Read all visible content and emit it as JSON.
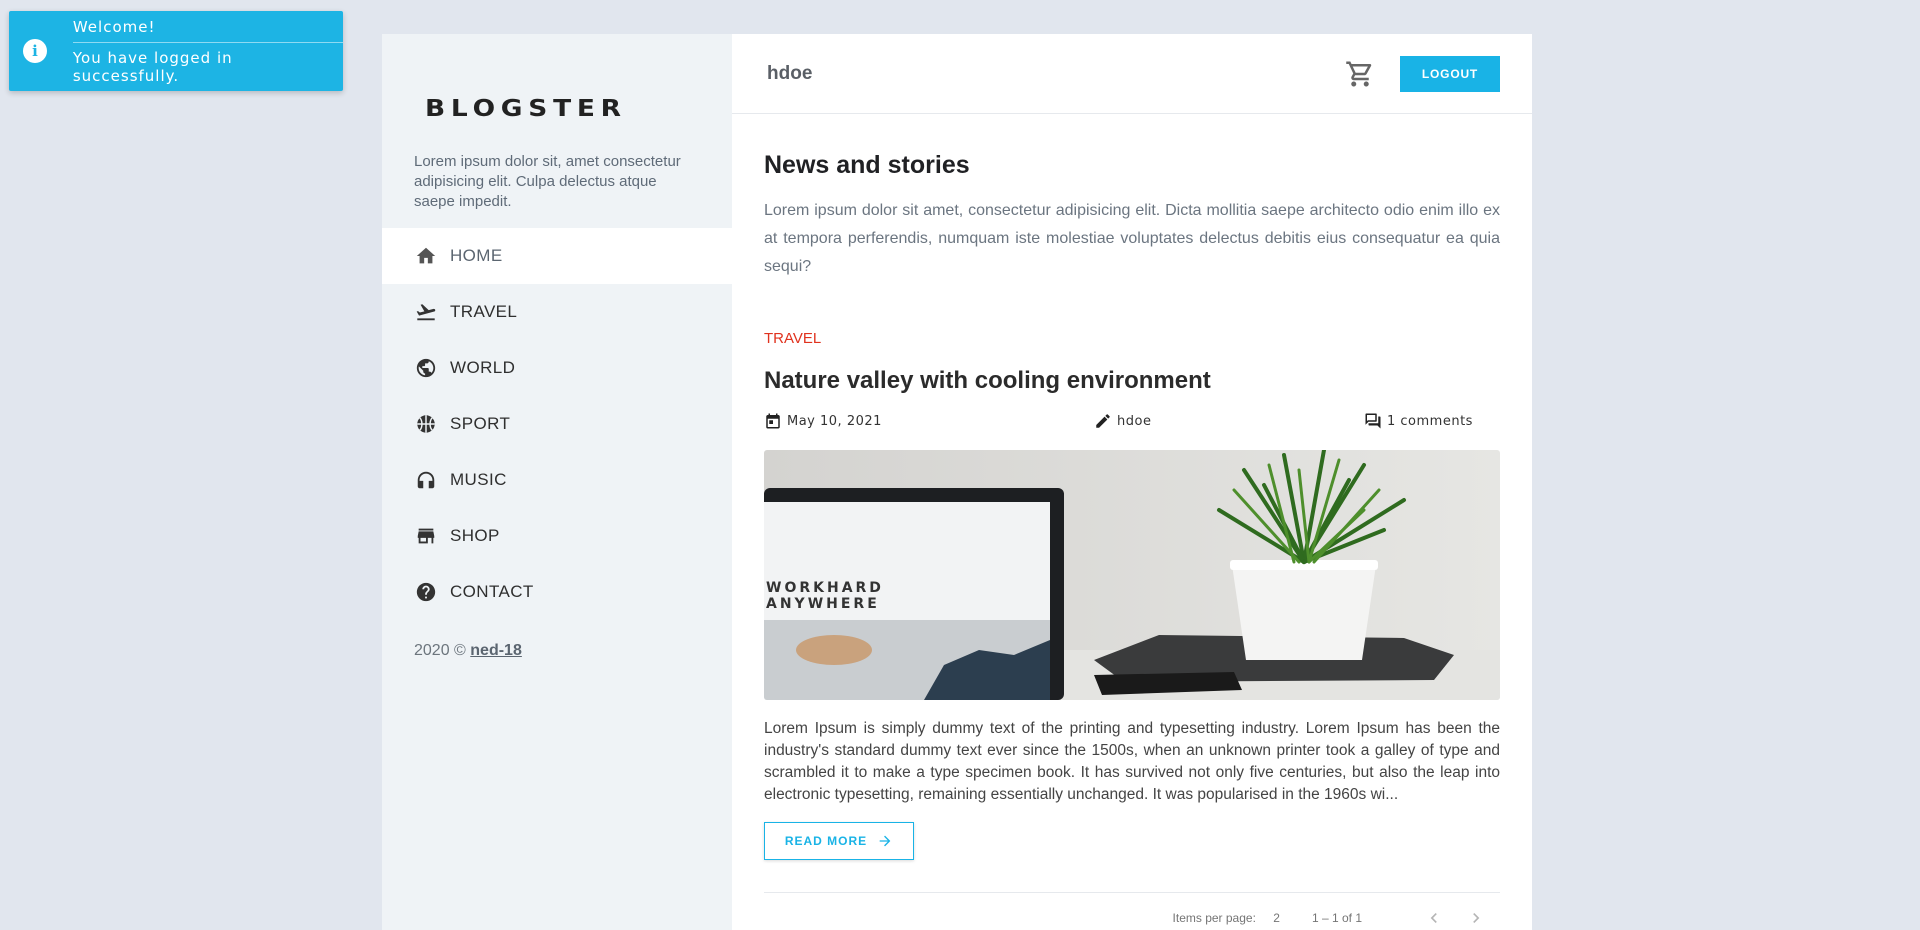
{
  "toast": {
    "title": "Welcome!",
    "message": "You have logged in successfully.",
    "icon": "info-icon",
    "color": "#1db4e4"
  },
  "sidebar": {
    "logo": "BLOGSTER",
    "tagline": "Lorem ipsum dolor sit, amet consectetur adipisicing elit. Culpa delectus atque saepe impedit.",
    "items": [
      {
        "label": "HOME",
        "icon": "home-icon",
        "active": true
      },
      {
        "label": "TRAVEL",
        "icon": "airplane-takeoff-icon"
      },
      {
        "label": "WORLD",
        "icon": "globe-icon"
      },
      {
        "label": "SPORT",
        "icon": "basketball-icon"
      },
      {
        "label": "MUSIC",
        "icon": "headphones-icon"
      },
      {
        "label": "SHOP",
        "icon": "store-icon"
      },
      {
        "label": "CONTACT",
        "icon": "help-circle-icon"
      }
    ],
    "copyright_prefix": "2020 ©",
    "copyright_link": "ned-18"
  },
  "header": {
    "username": "hdoe",
    "cart_icon": "shopping-cart-icon",
    "logout_label": "LOGOUT",
    "accent": "#19b3e6"
  },
  "main": {
    "heading": "News and stories",
    "intro": "Lorem ipsum dolor sit amet, consectetur adipisicing elit. Dicta mollitia saepe architecto odio enim illo ex at tempora perferendis, numquam iste molestiae voluptates delectus debitis eius consequatur ea quia sequi?",
    "post": {
      "category": "TRAVEL",
      "title": "Nature valley with cooling environment",
      "date": "May 10, 2021",
      "author": "hdoe",
      "comments": "1 comments",
      "image_text_line1": "WORKHARD",
      "image_text_line2": "ANYWHERE",
      "excerpt": "Lorem Ipsum is simply dummy text of the printing and typesetting industry. Lorem Ipsum has been the industry's standard dummy text ever since the 1500s, when an unknown printer took a galley of type and scrambled it to make a type specimen book. It has survived not only five centuries, but also the leap into electronic typesetting, remaining essentially unchanged. It was popularised in the 1960s wi...",
      "read_more": "READ MORE"
    },
    "paginator": {
      "items_per_page_label": "Items per page:",
      "items_per_page_value": "2",
      "range": "1 – 1 of 1"
    }
  }
}
